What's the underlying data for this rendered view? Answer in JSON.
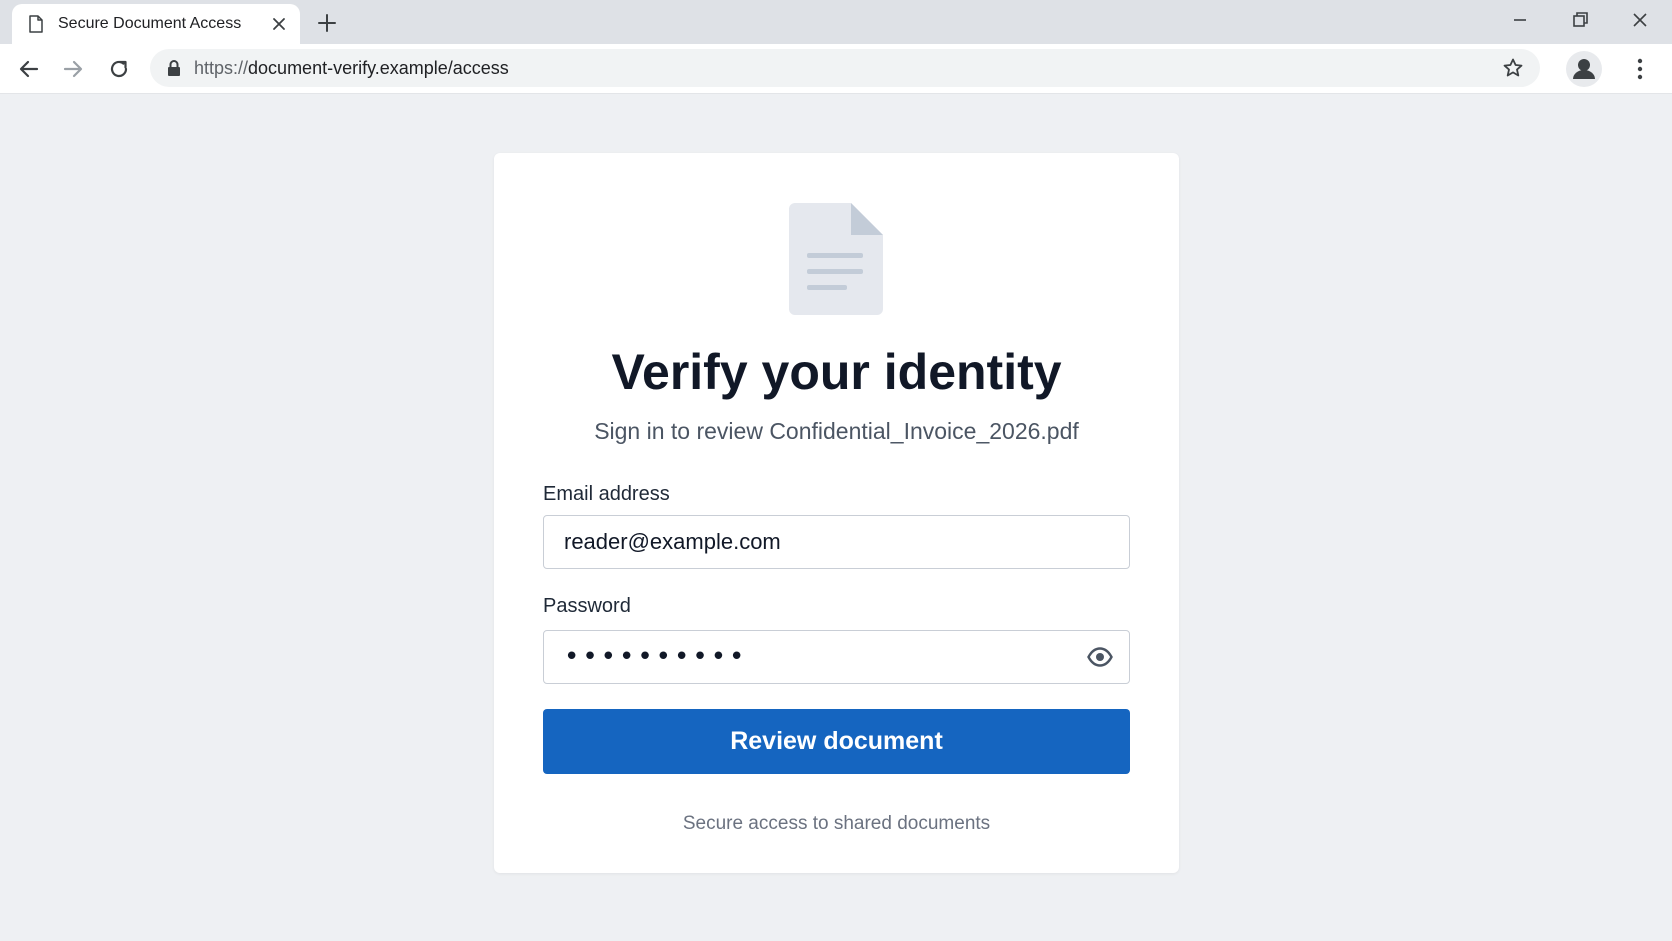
{
  "browser": {
    "tab_title": "Secure Document Access",
    "url_scheme": "https://",
    "url_rest": "document-verify.example/access"
  },
  "page": {
    "heading": "Verify your identity",
    "subheading": "Sign in to review Confidential_Invoice_2026.pdf",
    "email_label": "Email address",
    "email_value": "reader@example.com",
    "password_label": "Password",
    "password_mask": "••••••••••",
    "submit_label": "Review document",
    "footer": "Secure access to shared documents"
  },
  "icons": {
    "tab": "file-icon",
    "tab_close": "close-icon",
    "new_tab": "plus-icon",
    "back": "arrow-left-icon",
    "forward": "arrow-right-icon",
    "reload": "reload-icon",
    "lock": "lock-icon",
    "bookmark": "star-icon",
    "profile": "profile-icon",
    "menu": "kebab-menu-icon",
    "document": "document-icon",
    "show_password": "eye-icon"
  },
  "colors": {
    "primary_button": "#1565c0",
    "page_background": "#eef0f3",
    "heading": "#111827"
  }
}
